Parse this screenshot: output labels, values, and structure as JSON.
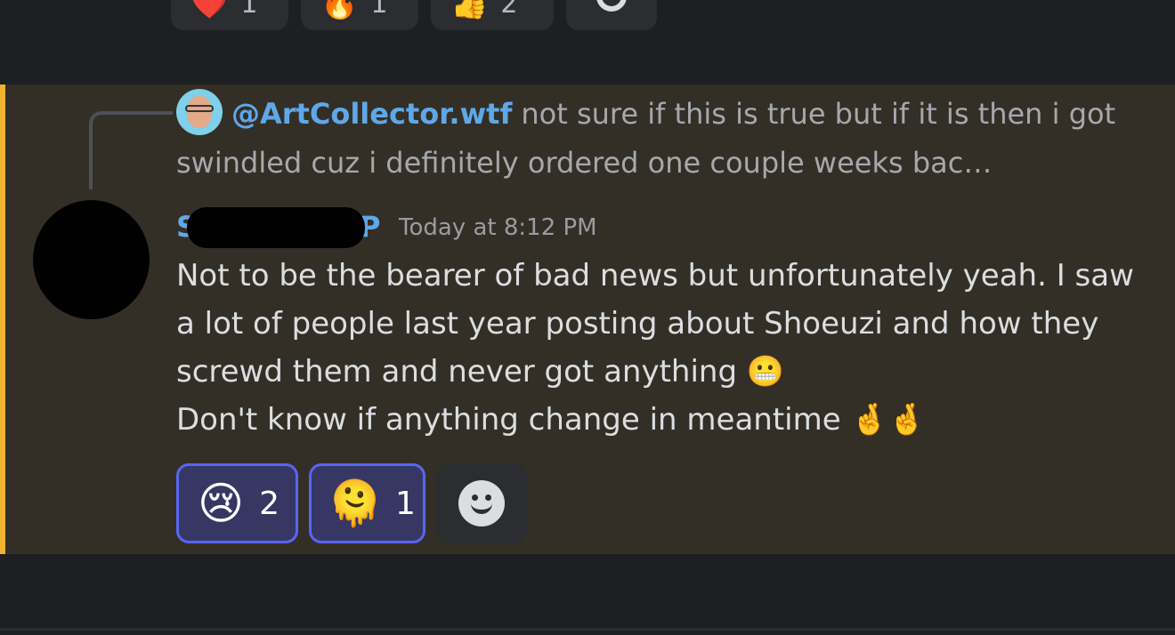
{
  "previous_message": {
    "reactions": [
      {
        "emoji": "❤️",
        "icon": "heart-icon",
        "count": "1"
      },
      {
        "emoji": "🔥",
        "icon": "fire-icon",
        "count": "1"
      },
      {
        "emoji": "👍",
        "icon": "thumbs-up-icon",
        "count": "2"
      }
    ]
  },
  "message": {
    "reply": {
      "author": "@ArtCollector.wtf",
      "text": "not sure if this is true but if it is then i got swindled cuz i definitely ordered one couple weeks bac…"
    },
    "author": "S",
    "author_suffix": "P",
    "timestamp": "Today at 8:12 PM",
    "lines": [
      "Not to be the bearer of bad news but unfortunately yeah. I saw a lot of people last year posting about Shoeuzi and how they screwd them and never got anything 😬",
      "Don't know if anything change in meantime 🤞🤞"
    ],
    "reactions": [
      {
        "emoji": "😢",
        "icon": "crying-face-icon",
        "count": "2"
      },
      {
        "emoji": "🫠",
        "icon": "melting-face-icon",
        "count": "1"
      }
    ],
    "highlight_color": "#f0b232",
    "author_color": "#5fa8e8"
  }
}
